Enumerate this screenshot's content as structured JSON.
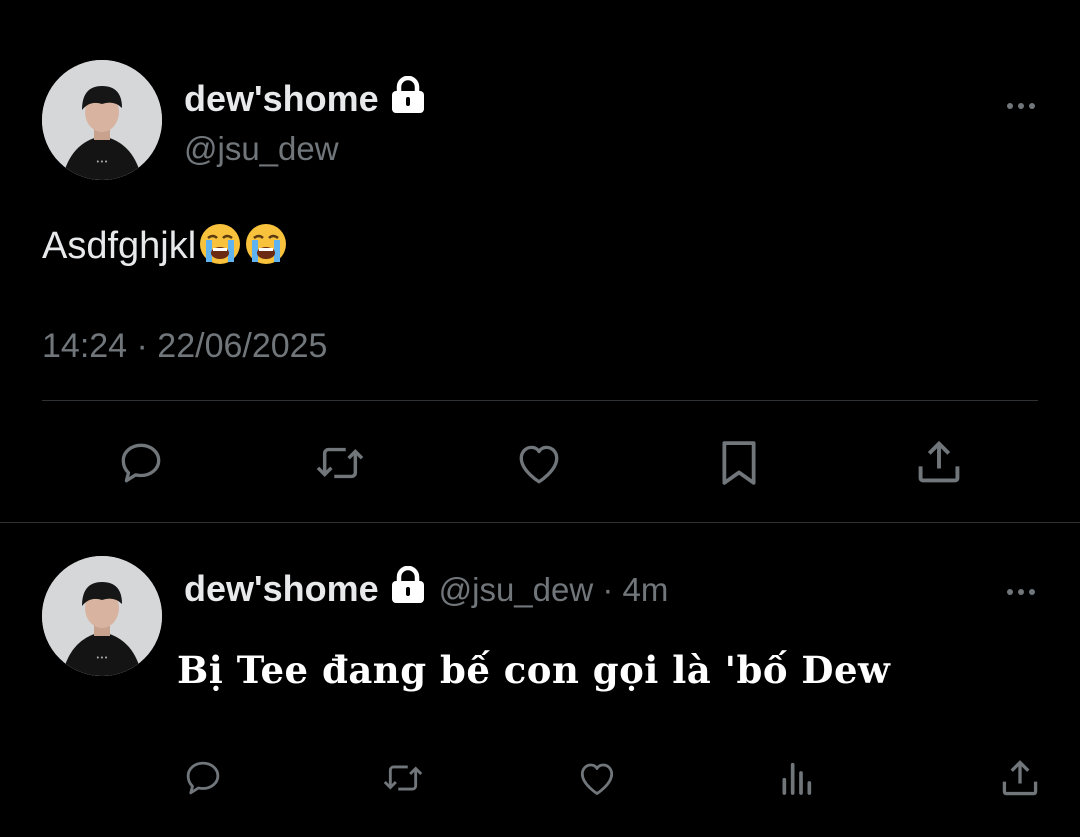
{
  "main_tweet": {
    "display_name": "dew'shome",
    "handle": "@jsu_dew",
    "text": "Asdfghjkl",
    "emojis": [
      "loudly-crying-face-emoji",
      "loudly-crying-face-emoji"
    ],
    "timestamp": "14:24 · 22/06/2025",
    "actions": [
      "reply-icon",
      "retweet-icon",
      "like-icon",
      "bookmark-icon",
      "share-icon"
    ]
  },
  "reply_tweet": {
    "display_name": "dew'shome",
    "handle_time": "@jsu_dew · 4m",
    "text": "Bị Tee đang bế con gọi là 'bố Dew",
    "actions": [
      "reply-icon",
      "retweet-icon",
      "like-icon",
      "views-icon",
      "share-icon"
    ]
  },
  "colors": {
    "background": "#000000",
    "primary_text": "#e7e9ea",
    "secondary_text": "#71767b",
    "divider": "#2f3336",
    "icon": "#71767b"
  }
}
